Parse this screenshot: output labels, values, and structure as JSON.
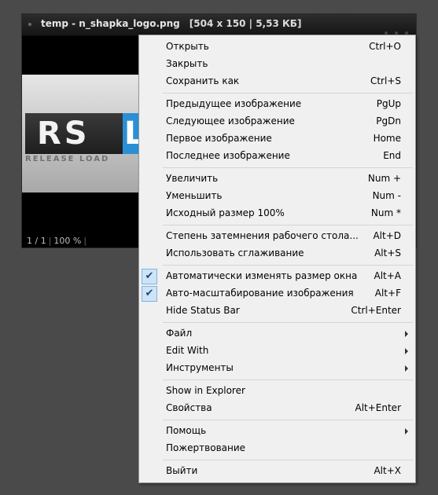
{
  "window": {
    "title": "temp - n_shapka_logo.png",
    "info": "[504 x 150  |  5,53 КБ]"
  },
  "image": {
    "logo_letters": "RS",
    "logo_accent_letter": "L",
    "logo_tagline": "RELEASE LOAD"
  },
  "status": {
    "index": "1 / 1",
    "zoom": "100 %"
  },
  "menu": {
    "items": [
      {
        "label": "Открыть",
        "shortcut": "Ctrl+O"
      },
      {
        "label": "Закрыть",
        "shortcut": ""
      },
      {
        "label": "Сохранить как",
        "shortcut": "Ctrl+S"
      },
      {
        "label": "Предыдущее изображение",
        "shortcut": "PgUp"
      },
      {
        "label": "Следующее изображение",
        "shortcut": "PgDn"
      },
      {
        "label": "Первое изображение",
        "shortcut": "Home"
      },
      {
        "label": "Последнее изображение",
        "shortcut": "End"
      },
      {
        "label": "Увеличить",
        "shortcut": "Num +"
      },
      {
        "label": "Уменьшить",
        "shortcut": "Num -"
      },
      {
        "label": "Исходный размер 100%",
        "shortcut": "Num *"
      },
      {
        "label": "Степень затемнения рабочего стола...",
        "shortcut": "Alt+D"
      },
      {
        "label": "Использовать сглаживание",
        "shortcut": "Alt+S"
      },
      {
        "label": "Автоматически изменять размер окна",
        "shortcut": "Alt+A",
        "checked": true
      },
      {
        "label": "Авто-масштабирование изображения",
        "shortcut": "Alt+F",
        "checked": true
      },
      {
        "label": "Hide Status Bar",
        "shortcut": "Ctrl+Enter"
      },
      {
        "label": "Файл",
        "submenu": true
      },
      {
        "label": "Edit With",
        "submenu": true
      },
      {
        "label": "Инструменты",
        "submenu": true
      },
      {
        "label": "Show in Explorer",
        "shortcut": ""
      },
      {
        "label": "Свойства",
        "shortcut": "Alt+Enter"
      },
      {
        "label": "Помощь",
        "submenu": true
      },
      {
        "label": "Пожертвование",
        "shortcut": ""
      },
      {
        "label": "Выйти",
        "shortcut": "Alt+X"
      }
    ],
    "check_glyph": "✔"
  }
}
